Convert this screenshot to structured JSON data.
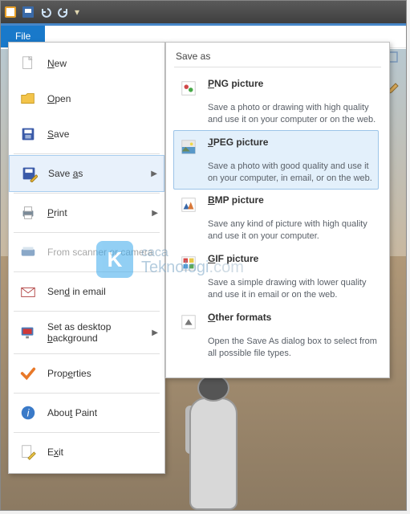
{
  "titlebar": {
    "icons": [
      "app",
      "save",
      "undo",
      "redo",
      "customize"
    ]
  },
  "file_tab": {
    "label": "File"
  },
  "file_menu": {
    "items": [
      {
        "key": "new",
        "label": "New",
        "icon": "page",
        "submenu": false
      },
      {
        "key": "open",
        "label": "Open",
        "icon": "folder",
        "submenu": false
      },
      {
        "key": "save",
        "label": "Save",
        "icon": "floppy",
        "submenu": false
      },
      {
        "type": "sep"
      },
      {
        "key": "saveas",
        "label": "Save as",
        "icon": "floppy-pencil",
        "submenu": true,
        "hovered": true
      },
      {
        "type": "sep"
      },
      {
        "key": "print",
        "label": "Print",
        "icon": "printer",
        "submenu": true
      },
      {
        "type": "sep"
      },
      {
        "key": "scanner",
        "label": "From scanner or camera",
        "icon": "scanner",
        "submenu": false,
        "disabled": true
      },
      {
        "type": "sep"
      },
      {
        "key": "email",
        "label": "Send in email",
        "icon": "mail",
        "submenu": false
      },
      {
        "type": "sep"
      },
      {
        "key": "wallpaper",
        "label": "Set as desktop background",
        "icon": "desktop",
        "submenu": true
      },
      {
        "type": "sep"
      },
      {
        "key": "properties",
        "label": "Properties",
        "icon": "check",
        "submenu": false
      },
      {
        "type": "sep"
      },
      {
        "key": "about",
        "label": "About Paint",
        "icon": "info",
        "submenu": false
      },
      {
        "type": "sep"
      },
      {
        "key": "exit",
        "label": "Exit",
        "icon": "exit",
        "submenu": false
      }
    ]
  },
  "saveas": {
    "header": "Save as",
    "options": [
      {
        "key": "png",
        "title": "PNG picture",
        "desc": "Save a photo or drawing with high quality and use it on your computer or on the web.",
        "icon": "png"
      },
      {
        "key": "jpeg",
        "title": "JPEG picture",
        "desc": "Save a photo with good quality and use it on your computer, in email, or on the web.",
        "icon": "jpeg",
        "highlight": true
      },
      {
        "key": "bmp",
        "title": "BMP picture",
        "desc": "Save any kind of picture with high quality and use it on your computer.",
        "icon": "bmp"
      },
      {
        "key": "gif",
        "title": "GIF picture",
        "desc": "Save a simple drawing with lower quality and use it in email or on the web.",
        "icon": "gif"
      },
      {
        "key": "other",
        "title": "Other formats",
        "desc": "Open the Save As dialog box to select from all possible file types.",
        "icon": "other"
      }
    ]
  },
  "watermark": {
    "letter": "K",
    "line1": "caca",
    "line2": "Teknologi",
    "suffix": ".com"
  },
  "colors": {
    "accent": "#1979ca",
    "highlight_bg": "#e3f0fb",
    "highlight_border": "#9cc4e8"
  }
}
